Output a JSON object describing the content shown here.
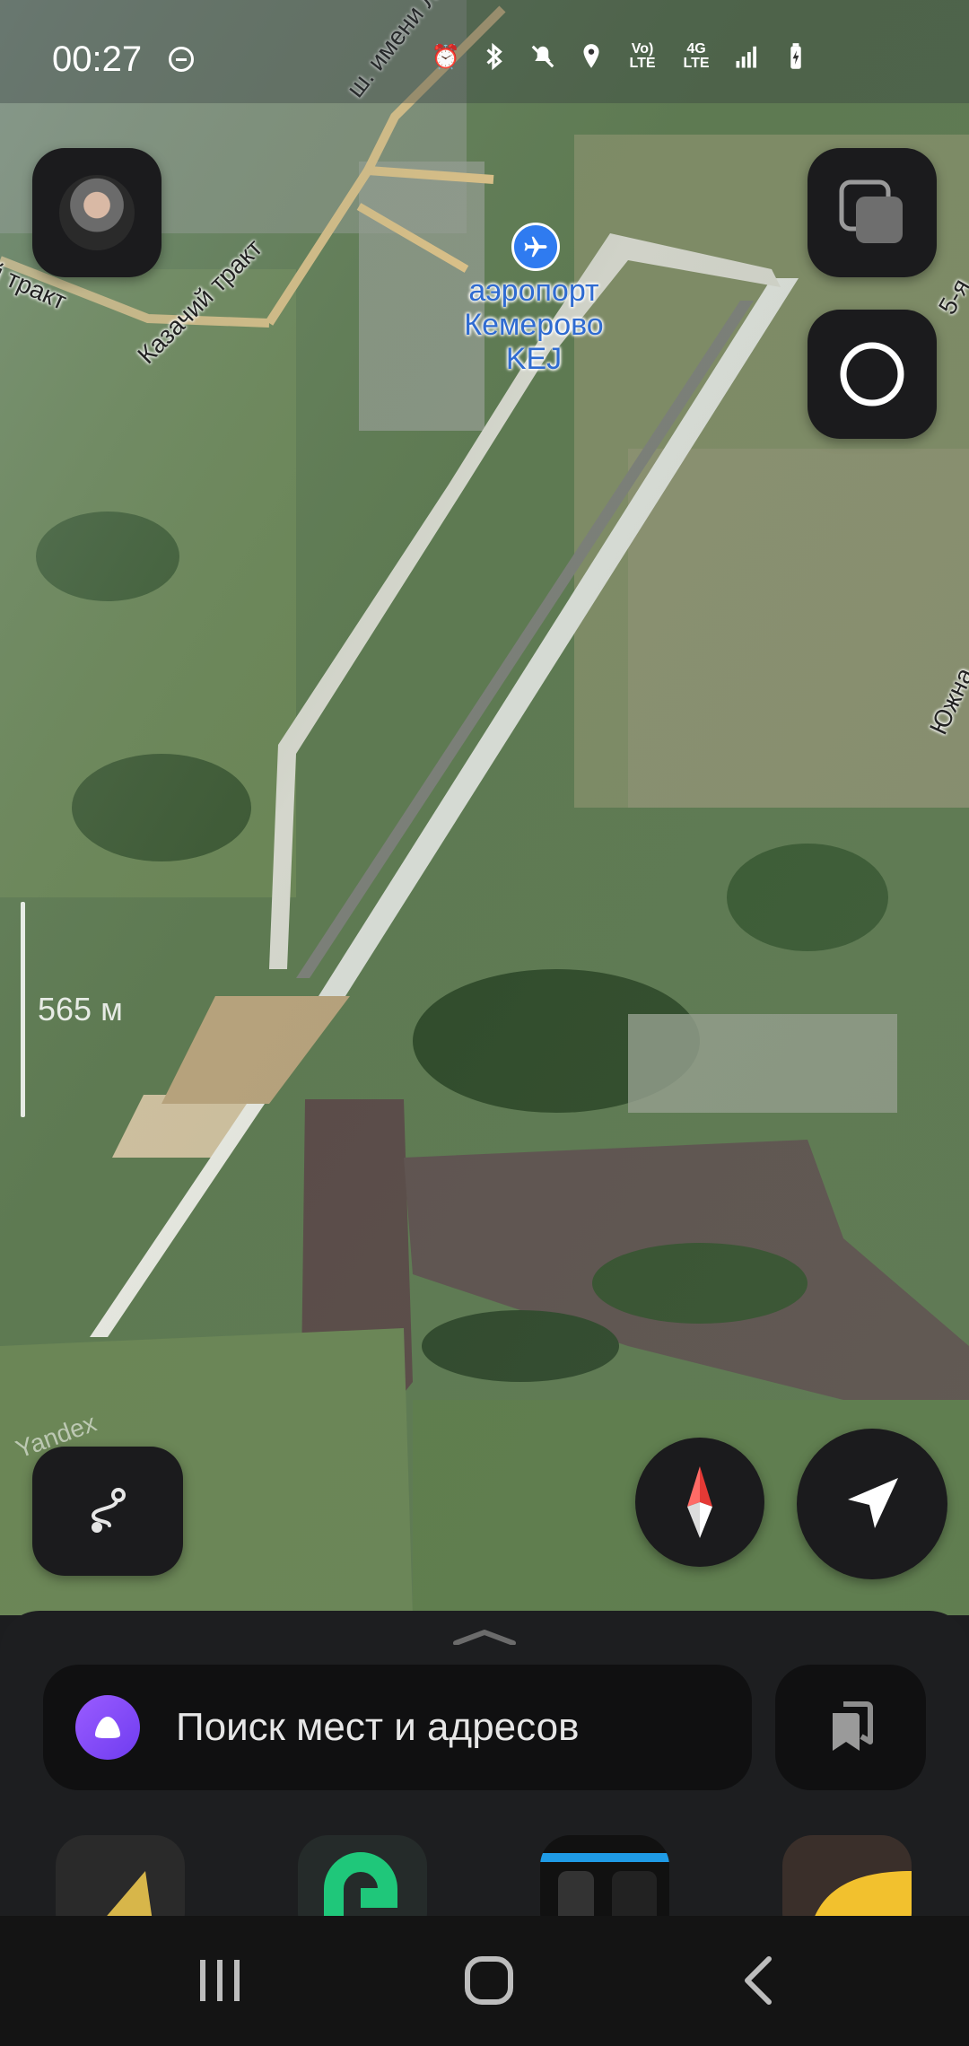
{
  "status": {
    "time": "00:27",
    "icons": [
      "dnd-icon",
      "alarm-icon",
      "bluetooth-icon",
      "mute-icon",
      "location-icon",
      "volte-icon",
      "4g-lte-icon",
      "signal-icon",
      "battery-icon"
    ],
    "volte_label": "Vo) LTE",
    "lte_label": "4G LTE"
  },
  "map": {
    "scale_label": "565 м",
    "airport_label": "аэропорт Кемерово KEJ",
    "airport_name_line1": "аэропорт",
    "airport_name_line2": "Кемерово",
    "airport_code": "KEJ",
    "roads": {
      "leonov": "ш. имени Леонова",
      "kazachiy_1": "Казачий тракт",
      "kazachiy_2": "й тракт",
      "right_top": "5-я",
      "right_mid": "Южна"
    },
    "watermark": "Yandex"
  },
  "search": {
    "placeholder": "Поиск мест и адресов"
  },
  "apps": [
    "navigator-app",
    "rideshare-app",
    "metro-app",
    "taxi-app"
  ],
  "nav": [
    "recents",
    "home",
    "back"
  ],
  "colors": {
    "accent": "#2f7bf0",
    "alice": "#7d48f5",
    "compass_red": "#e53935"
  }
}
